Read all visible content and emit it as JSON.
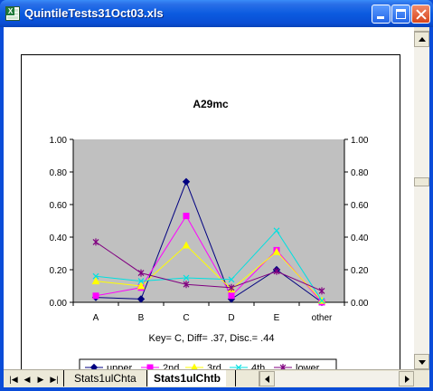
{
  "window": {
    "title": "QuintileTests31Oct03.xls",
    "app_icon_letter": "X"
  },
  "chart_data": {
    "type": "line",
    "title": "A29mc",
    "subtitle": "Key= C,  Diff= .37,  Disc.= .44",
    "categories": [
      "A",
      "B",
      "C",
      "D",
      "E",
      "other"
    ],
    "ylim": [
      0,
      1
    ],
    "yticks": [
      "0.00",
      "0.20",
      "0.40",
      "0.60",
      "0.80",
      "1.00"
    ],
    "ytick_values": [
      0,
      0.2,
      0.4,
      0.6,
      0.8,
      1.0
    ],
    "plot_background": "#c0c0c0",
    "legend_position": "bottom",
    "series": [
      {
        "name": "upper",
        "color": "#000080",
        "marker": "diamond",
        "values": [
          0.03,
          0.02,
          0.74,
          0.02,
          0.2,
          0.0
        ]
      },
      {
        "name": "2nd",
        "color": "#ff00ff",
        "marker": "square",
        "values": [
          0.04,
          0.09,
          0.53,
          0.04,
          0.32,
          0.0
        ]
      },
      {
        "name": "3rd",
        "color": "#ffff00",
        "marker": "triangle",
        "values": [
          0.13,
          0.1,
          0.35,
          0.08,
          0.31,
          0.01
        ]
      },
      {
        "name": "4th",
        "color": "#00e0e0",
        "marker": "x",
        "values": [
          0.16,
          0.13,
          0.15,
          0.14,
          0.44,
          0.01
        ]
      },
      {
        "name": "lower",
        "color": "#800080",
        "marker": "asterisk",
        "values": [
          0.37,
          0.18,
          0.11,
          0.09,
          0.19,
          0.07
        ]
      }
    ]
  },
  "sheet_tabs": [
    {
      "label": "Stats1ulChta",
      "active": false
    },
    {
      "label": "Stats1ulChtb",
      "active": true
    }
  ],
  "nav_buttons": [
    "first-sheet",
    "prev-sheet",
    "next-sheet",
    "last-sheet"
  ]
}
